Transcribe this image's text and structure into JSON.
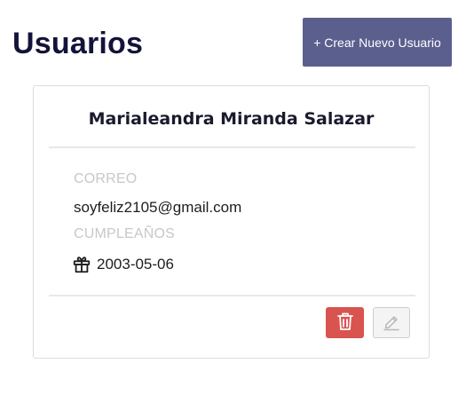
{
  "header": {
    "title": "Usuarios",
    "create_button_label": "+ Crear Nuevo Usuario"
  },
  "user_card": {
    "name": "Marialeandra Miranda Salazar",
    "email_label": "CORREO",
    "email": "soyfeliz2105@gmail.com",
    "birthday_label": "CUMPLEAÑOS",
    "birthday": "2003-05-06",
    "birthday_icon": "gift-icon",
    "actions": {
      "delete_icon": "trash-icon",
      "edit_icon": "pencil-icon"
    }
  },
  "colors": {
    "title": "#14133a",
    "create_button_bg": "#5b5f8e",
    "delete_button_bg": "#d9534f",
    "label_text": "#c8c8c8",
    "card_border": "#dcdcdc"
  }
}
